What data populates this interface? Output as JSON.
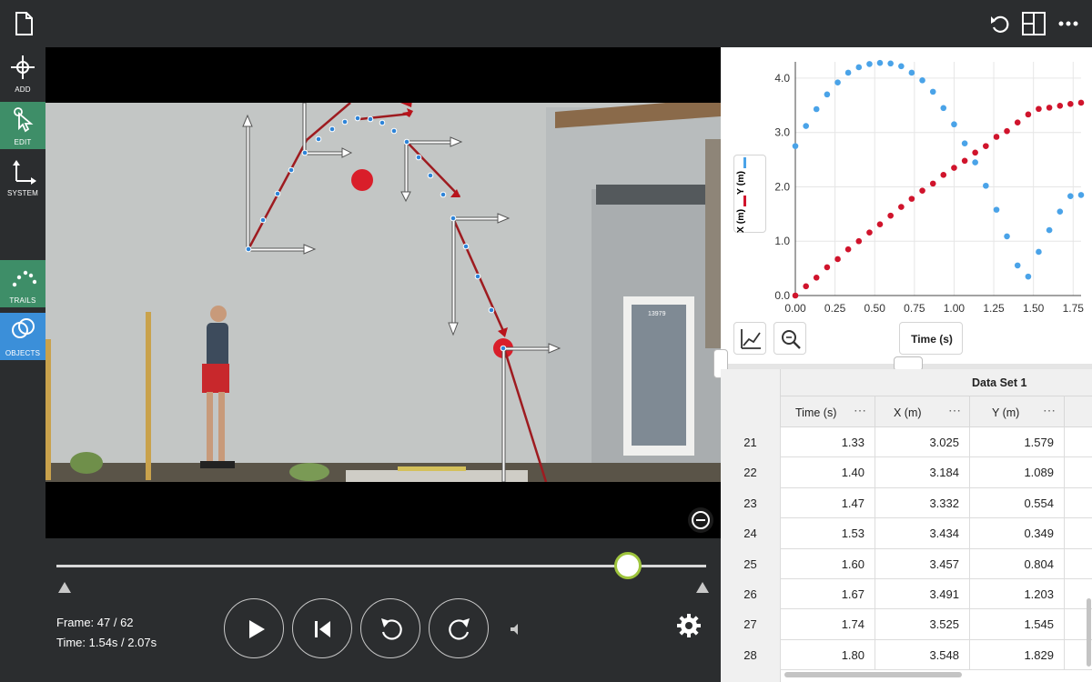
{
  "toolbar": {
    "tools": [
      {
        "label": "ADD",
        "icon": "add-point-icon"
      },
      {
        "label": "EDIT",
        "icon": "edit-pointer-icon",
        "active": true
      },
      {
        "label": "SYSTEM",
        "icon": "axes-icon"
      },
      {
        "label": "TRAILS",
        "icon": "trails-icon",
        "active": true
      },
      {
        "label": "OBJECTS",
        "icon": "objects-icon",
        "active": true
      }
    ]
  },
  "topbar": {
    "icons": [
      "document-icon",
      "undo-icon",
      "layout-icon",
      "more-icon"
    ]
  },
  "video": {
    "door_number": "13979"
  },
  "playback": {
    "frame_text": "Frame: 47 / 62",
    "time_text": "Time: 1.54s / 2.07s",
    "progress": 0.88
  },
  "graph": {
    "x_axis_button": "Time (s)",
    "legend": [
      "X (m)",
      "Y (m)"
    ],
    "colors": {
      "x": "#d0142c",
      "y": "#4aa3e8"
    }
  },
  "chart_data": {
    "type": "scatter",
    "xlabel": "Time (s)",
    "xlim": [
      0,
      1.8
    ],
    "ylim": [
      0,
      4.3
    ],
    "x_ticks": [
      "0.00",
      "0.25",
      "0.50",
      "0.75",
      "1.00",
      "1.25",
      "1.50",
      "1.75"
    ],
    "y_ticks": [
      "0.0",
      "1.0",
      "2.0",
      "3.0",
      "4.0"
    ],
    "series": [
      {
        "name": "X (m)",
        "color": "#d0142c",
        "x": [
          0.0,
          0.067,
          0.133,
          0.2,
          0.267,
          0.333,
          0.4,
          0.467,
          0.533,
          0.6,
          0.667,
          0.733,
          0.8,
          0.867,
          0.933,
          1.0,
          1.067,
          1.133,
          1.2,
          1.267,
          1.333,
          1.4,
          1.467,
          1.533,
          1.6,
          1.667,
          1.733,
          1.8
        ],
        "y": [
          0.0,
          0.17,
          0.33,
          0.52,
          0.67,
          0.85,
          1.0,
          1.16,
          1.31,
          1.47,
          1.63,
          1.78,
          1.93,
          2.06,
          2.22,
          2.35,
          2.48,
          2.63,
          2.75,
          2.92,
          3.025,
          3.184,
          3.332,
          3.434,
          3.457,
          3.491,
          3.525,
          3.548
        ]
      },
      {
        "name": "Y (m)",
        "color": "#4aa3e8",
        "x": [
          0.0,
          0.067,
          0.133,
          0.2,
          0.267,
          0.333,
          0.4,
          0.467,
          0.533,
          0.6,
          0.667,
          0.733,
          0.8,
          0.867,
          0.933,
          1.0,
          1.067,
          1.133,
          1.2,
          1.267,
          1.333,
          1.4,
          1.467,
          1.533,
          1.6,
          1.667,
          1.733,
          1.8
        ],
        "y": [
          2.75,
          3.12,
          3.43,
          3.7,
          3.92,
          4.1,
          4.2,
          4.26,
          4.28,
          4.27,
          4.22,
          4.1,
          3.96,
          3.75,
          3.45,
          3.15,
          2.8,
          2.45,
          2.02,
          1.579,
          1.089,
          0.554,
          0.349,
          0.804,
          1.203,
          1.545,
          1.829,
          1.85
        ]
      }
    ]
  },
  "table": {
    "title": "Data Set 1",
    "columns": [
      "Time (s)",
      "X (m)",
      "Y (m)"
    ],
    "rows": [
      {
        "n": "21",
        "t": "1.33",
        "x": "3.025",
        "y": "1.579"
      },
      {
        "n": "22",
        "t": "1.40",
        "x": "3.184",
        "y": "1.089"
      },
      {
        "n": "23",
        "t": "1.47",
        "x": "3.332",
        "y": "0.554"
      },
      {
        "n": "24",
        "t": "1.53",
        "x": "3.434",
        "y": "0.349"
      },
      {
        "n": "25",
        "t": "1.60",
        "x": "3.457",
        "y": "0.804"
      },
      {
        "n": "26",
        "t": "1.67",
        "x": "3.491",
        "y": "1.203"
      },
      {
        "n": "27",
        "t": "1.74",
        "x": "3.525",
        "y": "1.545"
      },
      {
        "n": "28",
        "t": "1.80",
        "x": "3.548",
        "y": "1.829"
      }
    ]
  }
}
